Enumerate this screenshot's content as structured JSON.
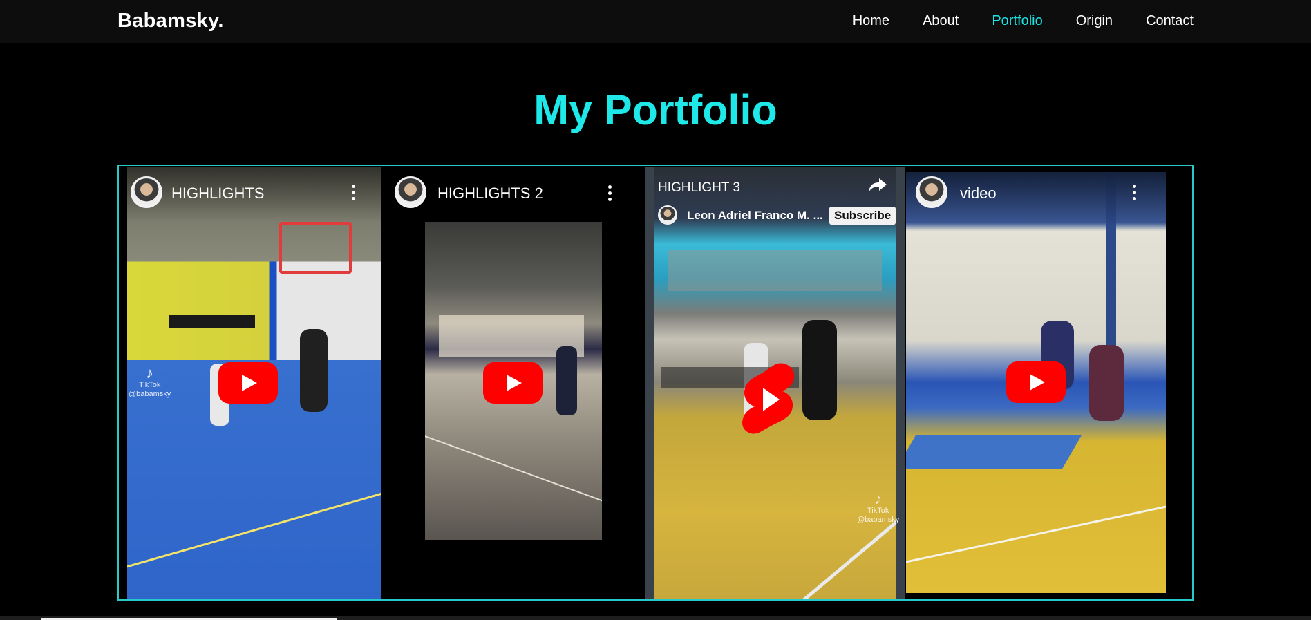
{
  "navbar": {
    "brand": "Babamsky.",
    "links": [
      {
        "label": "Home"
      },
      {
        "label": "About"
      },
      {
        "label": "Portfolio",
        "active": true
      },
      {
        "label": "Origin"
      },
      {
        "label": "Contact"
      }
    ]
  },
  "portfolio": {
    "heading": "My Portfolio",
    "accent_color": "#1ee8e8",
    "videos": [
      {
        "title": "HIGHLIGHTS",
        "watermark_brand": "TikTok",
        "watermark_user": "@babamsky",
        "player": "youtube"
      },
      {
        "title": "HIGHLIGHTS 2",
        "player": "youtube"
      },
      {
        "title": "HIGHLIGHT 3",
        "channel": "Leon Adriel Franco M. ...",
        "subscribe_label": "Subscribe",
        "watermark_brand": "TikTok",
        "watermark_user": "@babamsky",
        "player": "youtube-shorts"
      },
      {
        "title": "video",
        "player": "youtube"
      }
    ]
  },
  "icons": {
    "play": "play-button-icon",
    "shorts": "youtube-shorts-icon",
    "menu": "more-vert-icon",
    "share": "share-icon",
    "tiktok": "tiktok-icon"
  }
}
